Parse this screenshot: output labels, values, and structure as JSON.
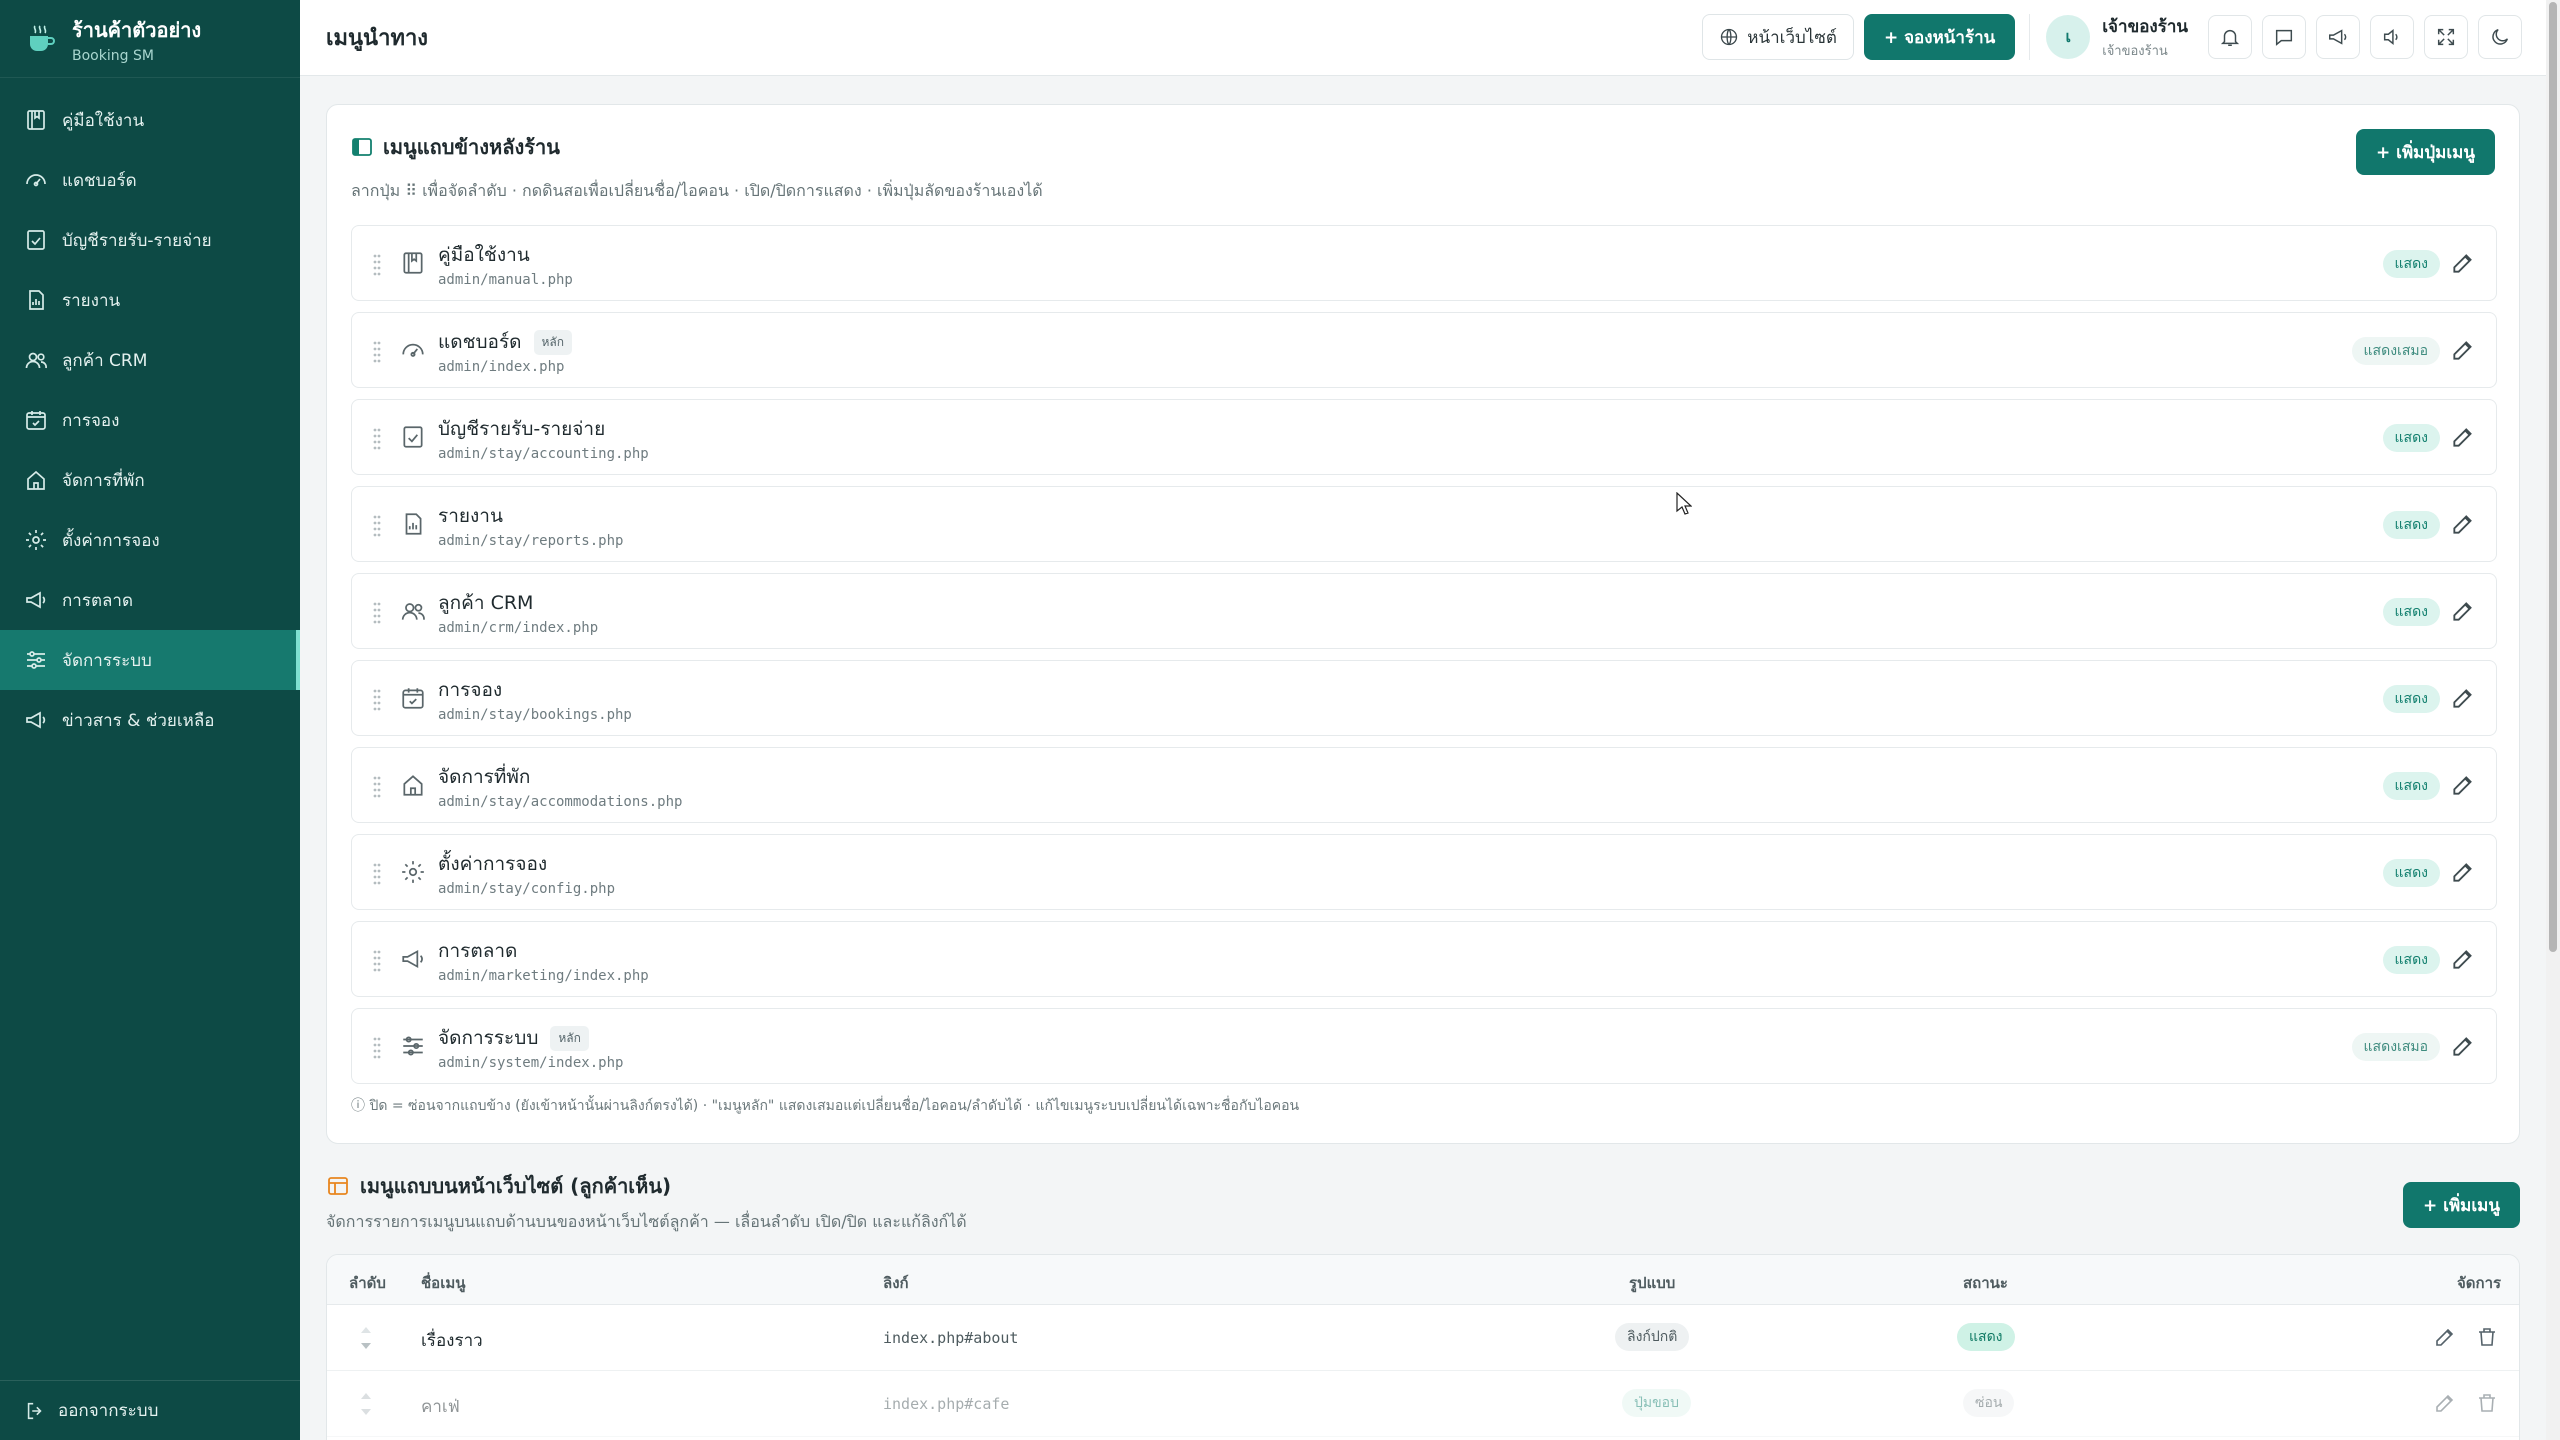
{
  "brand": {
    "title": "ร้านค้าตัวอย่าง",
    "subtitle": "Booking SM"
  },
  "sidebar": {
    "items": [
      {
        "label": "คู่มือใช้งาน",
        "icon": "book-icon"
      },
      {
        "label": "แดชบอร์ด",
        "icon": "gauge-icon"
      },
      {
        "label": "บัญชีรายรับ-รายจ่าย",
        "icon": "checklist-icon"
      },
      {
        "label": "รายงาน",
        "icon": "report-icon"
      },
      {
        "label": "ลูกค้า CRM",
        "icon": "users-icon"
      },
      {
        "label": "การจอง",
        "icon": "calendar-check-icon"
      },
      {
        "label": "จัดการที่พัก",
        "icon": "house-icon"
      },
      {
        "label": "ตั้งค่าการจอง",
        "icon": "gear-icon"
      },
      {
        "label": "การตลาด",
        "icon": "megaphone-icon"
      },
      {
        "label": "จัดการระบบ",
        "icon": "sliders-icon",
        "active": true
      },
      {
        "label": "ข่าวสาร & ช่วยเหลือ",
        "icon": "megaphone-icon"
      }
    ],
    "logout": "ออกจากระบบ"
  },
  "topbar": {
    "title": "เมนูนำทาง",
    "website_btn": "หน้าเว็บไซต์",
    "booking_btn": "+ จองหน้าร้าน",
    "user": {
      "avatar": "เ",
      "name": "เจ้าของร้าน",
      "role": "เจ้าของร้าน"
    }
  },
  "backend_menu": {
    "title": "เมนูแถบข้างหลังร้าน",
    "hint": "ลากปุ่ม ⠿ เพื่อจัดลำดับ · กดดินสอเพื่อเปลี่ยนชื่อ/ไอคอน · เปิด/ปิดการแสดง · เพิ่มปุ่มลัดของร้านเองได้",
    "add_button": "+ เพิ่มปุ่มเมนู",
    "items": [
      {
        "label": "คู่มือใช้งาน",
        "path": "admin/manual.php",
        "status": "แสดง",
        "icon": "book-icon"
      },
      {
        "label": "แดชบอร์ด",
        "path": "admin/index.php",
        "status": "แสดงเสมอ",
        "core": "หลัก",
        "icon": "gauge-icon"
      },
      {
        "label": "บัญชีรายรับ-รายจ่าย",
        "path": "admin/stay/accounting.php",
        "status": "แสดง",
        "icon": "checklist-icon"
      },
      {
        "label": "รายงาน",
        "path": "admin/stay/reports.php",
        "status": "แสดง",
        "icon": "report-icon"
      },
      {
        "label": "ลูกค้า CRM",
        "path": "admin/crm/index.php",
        "status": "แสดง",
        "icon": "users-icon"
      },
      {
        "label": "การจอง",
        "path": "admin/stay/bookings.php",
        "status": "แสดง",
        "icon": "calendar-check-icon"
      },
      {
        "label": "จัดการที่พัก",
        "path": "admin/stay/accommodations.php",
        "status": "แสดง",
        "icon": "house-icon"
      },
      {
        "label": "ตั้งค่าการจอง",
        "path": "admin/stay/config.php",
        "status": "แสดง",
        "icon": "gear-icon"
      },
      {
        "label": "การตลาด",
        "path": "admin/marketing/index.php",
        "status": "แสดง",
        "icon": "megaphone-icon"
      },
      {
        "label": "จัดการระบบ",
        "path": "admin/system/index.php",
        "status": "แสดงเสมอ",
        "core": "หลัก",
        "icon": "sliders-icon"
      }
    ],
    "note": "ⓘ ปิด = ซ่อนจากแถบข้าง (ยังเข้าหน้านั้นผ่านลิงก์ตรงได้) · \"เมนูหลัก\" แสดงเสมอแต่เปลี่ยนชื่อ/ไอคอน/ลำดับได้ · แก้ไขเมนูระบบเปลี่ยนได้เฉพาะชื่อกับไอคอน"
  },
  "frontend_menu": {
    "title": "เมนูแถบบนหน้าเว็บไซต์ (ลูกค้าเห็น)",
    "subtitle": "จัดการรายการเมนูบนแถบด้านบนของหน้าเว็บไซต์ลูกค้า — เลื่อนลำดับ เปิด/ปิด และแก้ลิงก์ได้",
    "add_button": "+ เพิ่มเมนู",
    "columns": [
      "ลำดับ",
      "ชื่อเมนู",
      "ลิงก์",
      "รูปแบบ",
      "สถานะ",
      "จัดการ"
    ],
    "rows": [
      {
        "name": "เรื่องราว",
        "link": "index.php#about",
        "style": "ลิงก์ปกติ",
        "status": "แสดง"
      },
      {
        "name": "คาเฟ่",
        "link": "index.php#cafe",
        "style": "ปุ่มขอบ",
        "status": "ซ่อน"
      }
    ]
  },
  "colors": {
    "sidebar": "#0d4a45",
    "accent": "#11776c",
    "active": "#16796e"
  }
}
